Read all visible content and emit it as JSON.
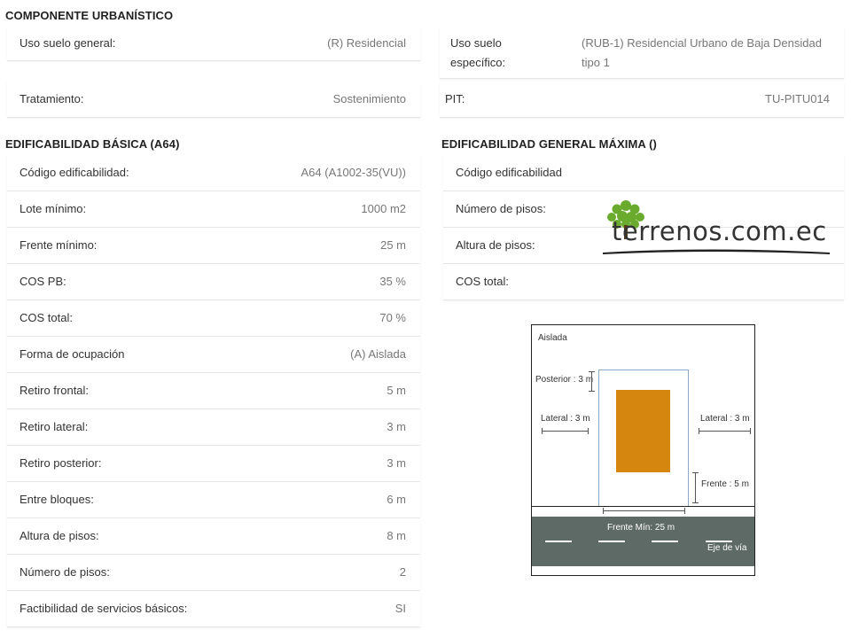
{
  "urban": {
    "title": "COMPONENTE URBANÍSTICO",
    "uso_general_label": "Uso suelo general:",
    "uso_general_value": "(R) Residencial",
    "uso_especifico_label_1": "Uso suelo",
    "uso_especifico_label_2": "específico:",
    "uso_especifico_value_1": "(RUB-1) Residencial Urbano de Baja Densidad",
    "uso_especifico_value_2": "tipo 1",
    "tratamiento_label": "Tratamiento:",
    "tratamiento_value": "Sostenimiento",
    "pit_label": "PIT:",
    "pit_value": "TU-PITU014"
  },
  "basica": {
    "title": "EDIFICABILIDAD BÁSICA (A64)",
    "rows": [
      {
        "label": "Código edificabilidad:",
        "value": "A64 (A1002-35(VU))"
      },
      {
        "label": "Lote mínimo:",
        "value": "1000 m2"
      },
      {
        "label": "Frente mínimo:",
        "value": "25 m"
      },
      {
        "label": "COS PB:",
        "value": "35 %"
      },
      {
        "label": "COS total:",
        "value": "70 %"
      },
      {
        "label": "Forma de ocupación",
        "value": "(A) Aislada"
      },
      {
        "label": "Retiro frontal:",
        "value": "5 m"
      },
      {
        "label": "Retiro lateral:",
        "value": "3 m"
      },
      {
        "label": "Retiro posterior:",
        "value": "3 m"
      },
      {
        "label": "Entre bloques:",
        "value": "6 m"
      },
      {
        "label": "Altura de pisos:",
        "value": "8 m"
      },
      {
        "label": "Número de pisos:",
        "value": "2"
      },
      {
        "label": "Factibilidad de servicios básicos:",
        "value": "SI"
      }
    ]
  },
  "maxima": {
    "title": "EDIFICABILIDAD GENERAL MÁXIMA ()",
    "rows": [
      {
        "label": "Código edificabilidad"
      },
      {
        "label": "Número de pisos:"
      },
      {
        "label": "Altura de pisos:"
      },
      {
        "label": "COS total:"
      }
    ]
  },
  "diagram": {
    "title": "Aislada",
    "posterior": "Posterior : 3 m",
    "lateral_left": "Lateral : 3 m",
    "lateral_right": "Lateral : 3 m",
    "frente": "Frente : 5 m",
    "frente_min": "Frente Mín: 25 m",
    "eje": "Eje de vía",
    "colors": {
      "building": "#d4860f",
      "road": "#5e6a66"
    }
  },
  "logo": {
    "text": "terrenos.com.ec",
    "colors": {
      "tree": "#6aab2e",
      "text": "#333333"
    }
  }
}
